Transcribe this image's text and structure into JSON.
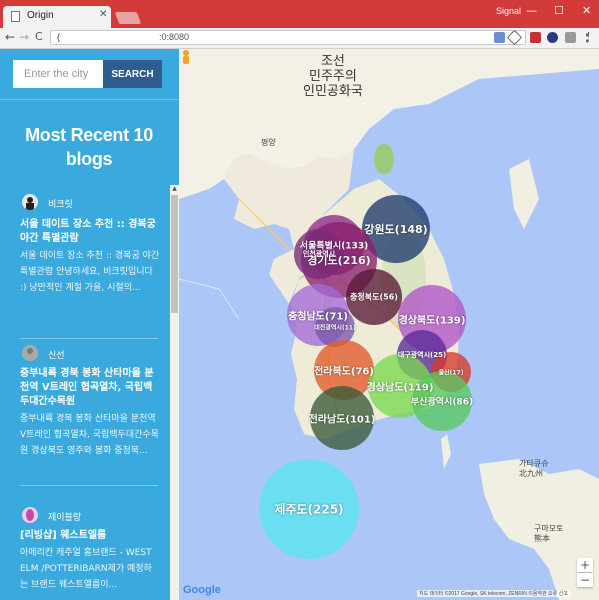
{
  "browser": {
    "tab_title": "Origin",
    "tab_close": "✕",
    "profile_name": "Signal",
    "window_min": "—",
    "window_max": "☐",
    "window_close": "✕",
    "back": "←",
    "forward": "→",
    "reload": "C",
    "url_prefix": "(",
    "url": ":0:8080"
  },
  "sidebar": {
    "search": {
      "placeholder": "Enter the city",
      "button_label": "SEARCH"
    },
    "heading": "Most Recent 10 blogs",
    "scroll_up": "▲",
    "posts": [
      {
        "author": "비크릿",
        "title": "서울 데이트 장소 추천 :: 경복궁 야간 특별관람",
        "excerpt": "서울 데이트 장소 추천 :: 경복궁 야간 특별관람 안녕하세요, 비크릿입니다 :) 낭만적인 계절 가을, 시절의..."
      },
      {
        "author": "신선",
        "title": "중부내륙 경북 봉화 산타마을 분천역 V트레인 협곡열차, 국립백두대간수목원",
        "excerpt": "중부내륙 경북 봉화 산타마을 분천역 V트레인 협곡열차, 국립백두대간수목원 경상북도 영주와 봉화 중청북..."
      },
      {
        "author": "제이블랑",
        "title": "[리빙샵] 웨스트엘름",
        "excerpt": "아메리칸 캐주얼 홈브랜드 - WEST ELM /POTTERIBARN제가 예정하는 브랜드 웨스트엘름이..."
      }
    ]
  },
  "map": {
    "labels": {
      "north_korea": "조선\n민주주의\n인민공화국",
      "pyongyang": "평양",
      "kyushu": "가타큐슈\n北九州",
      "kumamoto": "구마모토\n熊本",
      "google": "Google",
      "attribution": "지도 데이터 ©2017 Google, SK telecom, ZENRIN 이용약관 오류 신고",
      "zoom_in": "+",
      "zoom_out": "−"
    },
    "bubbles": [
      {
        "label": "강원도(148)",
        "color": "#1f3a6e"
      },
      {
        "label": "서울특별시(133)",
        "color": "#8e2a8a"
      },
      {
        "label": "경기도(216)",
        "color": "#8a1f6e"
      },
      {
        "label": "인천광역시",
        "color": "#7a2a7a"
      },
      {
        "label": "충청북도(56)",
        "color": "#5a1a3a"
      },
      {
        "label": "충청남도(71)",
        "color": "#a46ad8"
      },
      {
        "label": "대전광역시(11)",
        "color": "#7a5aa8"
      },
      {
        "label": "경상북도(139)",
        "color": "#b054c8"
      },
      {
        "label": "대구광역시(25)",
        "color": "#5a2a9a"
      },
      {
        "label": "울산(17)",
        "color": "#d63a2a"
      },
      {
        "label": "전라북도(76)",
        "color": "#e35a2a"
      },
      {
        "label": "경상남도(119)",
        "color": "#7ad850"
      },
      {
        "label": "부산광역시(86)",
        "color": "#58c860"
      },
      {
        "label": "전라남도(101)",
        "color": "#3a5a3a"
      },
      {
        "label": "제주도(225)",
        "color": "#56e6f0"
      }
    ]
  }
}
